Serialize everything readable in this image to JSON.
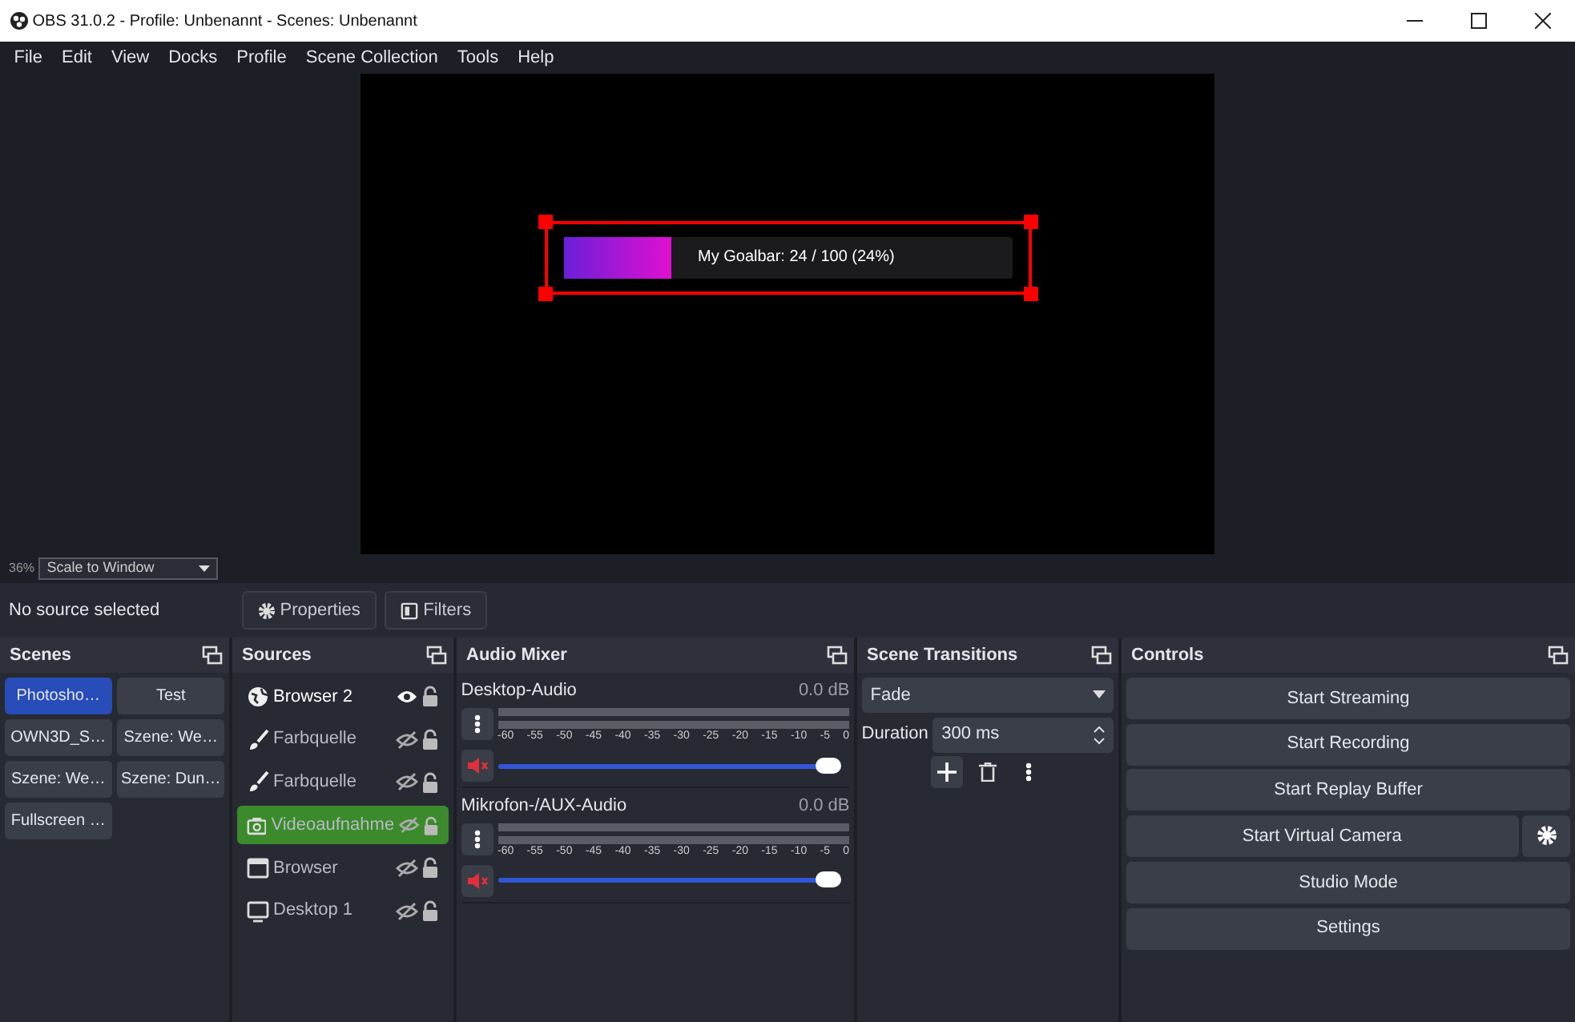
{
  "window": {
    "title": "OBS 31.0.2 - Profile: Unbenannt - Scenes: Unbenannt"
  },
  "menu": [
    "File",
    "Edit",
    "View",
    "Docks",
    "Profile",
    "Scene Collection",
    "Tools",
    "Help"
  ],
  "preview": {
    "selected": true,
    "goalbar": {
      "label": "My Goalbar: 24 / 100 (24%)",
      "level": 0.24
    }
  },
  "zoom": {
    "percent": "36%",
    "scale_mode": "Scale to Window"
  },
  "context_bar": {
    "status": "No source selected",
    "buttons": [
      {
        "label": "Properties",
        "kind": "properties"
      },
      {
        "label": "Filters",
        "kind": "filters"
      }
    ]
  },
  "scenes": {
    "title": "Scenes",
    "items": [
      {
        "name": "Photosho…",
        "selected": true
      },
      {
        "name": "Test",
        "selected": false
      },
      {
        "name": "OWN3D_S…",
        "selected": false
      },
      {
        "name": "Szene: We…",
        "selected": false
      },
      {
        "name": "Szene: We…",
        "selected": false
      },
      {
        "name": "Szene: Dun…",
        "selected": false
      },
      {
        "name": "Fullscreen …",
        "selected": false
      }
    ]
  },
  "sources": {
    "title": "Sources",
    "items": [
      {
        "name": "Browser 2",
        "kind": "globe",
        "visible": true,
        "locked": false,
        "selected": false
      },
      {
        "name": "Farbquelle",
        "kind": "color",
        "visible": false,
        "locked": false,
        "selected": false
      },
      {
        "name": "Farbquelle",
        "kind": "color",
        "visible": false,
        "locked": false,
        "selected": false
      },
      {
        "name": "Videoaufnahme",
        "kind": "camera",
        "visible": false,
        "locked": false,
        "selected": true
      },
      {
        "name": "Browser",
        "kind": "window",
        "visible": false,
        "locked": false,
        "selected": false
      },
      {
        "name": "Desktop 1",
        "kind": "display",
        "visible": false,
        "locked": false,
        "selected": false
      }
    ]
  },
  "audio_mixer": {
    "title": "Audio Mixer",
    "channels": [
      {
        "name": "Desktop-Audio",
        "reading": "0.0 dB",
        "muted": true,
        "level": 1.0,
        "scale": [
          "-60",
          "-55",
          "-50",
          "-45",
          "-40",
          "-35",
          "-30",
          "-25",
          "-20",
          "-15",
          "-10",
          "-5",
          "0"
        ]
      },
      {
        "name": "Mikrofon-/AUX-Audio",
        "reading": "0.0 dB",
        "muted": true,
        "level": 1.0,
        "scale": [
          "-60",
          "-55",
          "-50",
          "-45",
          "-40",
          "-35",
          "-30",
          "-25",
          "-20",
          "-15",
          "-10",
          "-5",
          "0"
        ]
      }
    ]
  },
  "scene_transitions": {
    "title": "Scene Transitions",
    "transition": "Fade",
    "duration_label": "Duration",
    "duration": "300 ms"
  },
  "controls": {
    "title": "Controls",
    "buttons": [
      {
        "label": "Start Streaming",
        "kind": "plain"
      },
      {
        "label": "Start Recording",
        "kind": "plain"
      },
      {
        "label": "Start Replay Buffer",
        "kind": "plain"
      },
      {
        "label": "Start Virtual Camera",
        "kind": "with-settings"
      },
      {
        "label": "Studio Mode",
        "kind": "plain"
      },
      {
        "label": "Settings",
        "kind": "plain"
      }
    ]
  }
}
